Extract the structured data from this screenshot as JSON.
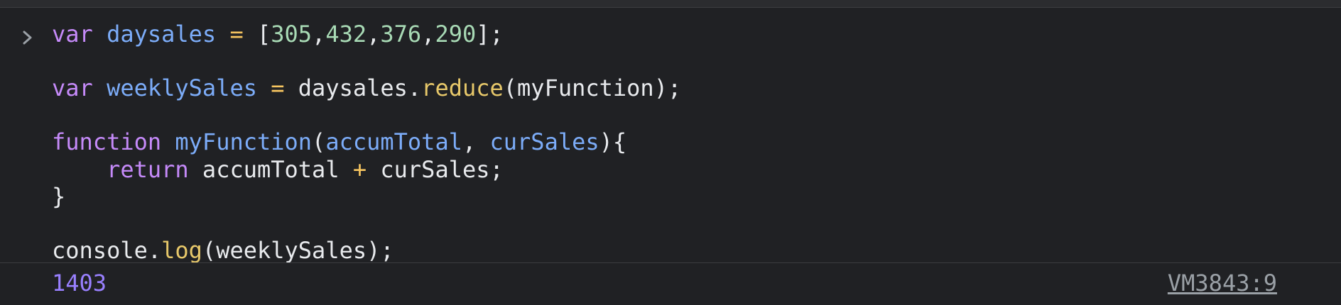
{
  "console": {
    "input": {
      "line1": {
        "kw": "var",
        "name": "daysales",
        "eq": " = ",
        "open": "[",
        "v1": "305",
        "c1": ",",
        "v2": "432",
        "c2": ",",
        "v3": "376",
        "c3": ",",
        "v4": "290",
        "close": "];"
      },
      "line2": {
        "kw": "var",
        "name": "weeklySales",
        "eq": " = ",
        "obj": "daysales.",
        "method": "reduce",
        "args": "(myFunction);"
      },
      "line3": {
        "kw": "function",
        "name": "myFunction",
        "open": "(",
        "p1": "accumTotal",
        "comma": ", ",
        "p2": "curSales",
        "close": "){"
      },
      "line4": {
        "indent": "    ",
        "kw": "return",
        "a": " accumTotal ",
        "op": "+",
        "b": " curSales;"
      },
      "line5": {
        "text": "}"
      },
      "line6": {
        "obj": "console.",
        "method": "log",
        "args": "(weeklySales);"
      }
    },
    "result": {
      "value": "1403",
      "source": "VM3843:9"
    },
    "icons": {
      "prompt": "chevron-right-icon"
    },
    "colors": {
      "background": "#202124",
      "keyword": "#c58af9",
      "variable": "#7cacf8",
      "number": "#a8dab5",
      "method": "#e7c86a",
      "result": "#9980ff"
    }
  }
}
